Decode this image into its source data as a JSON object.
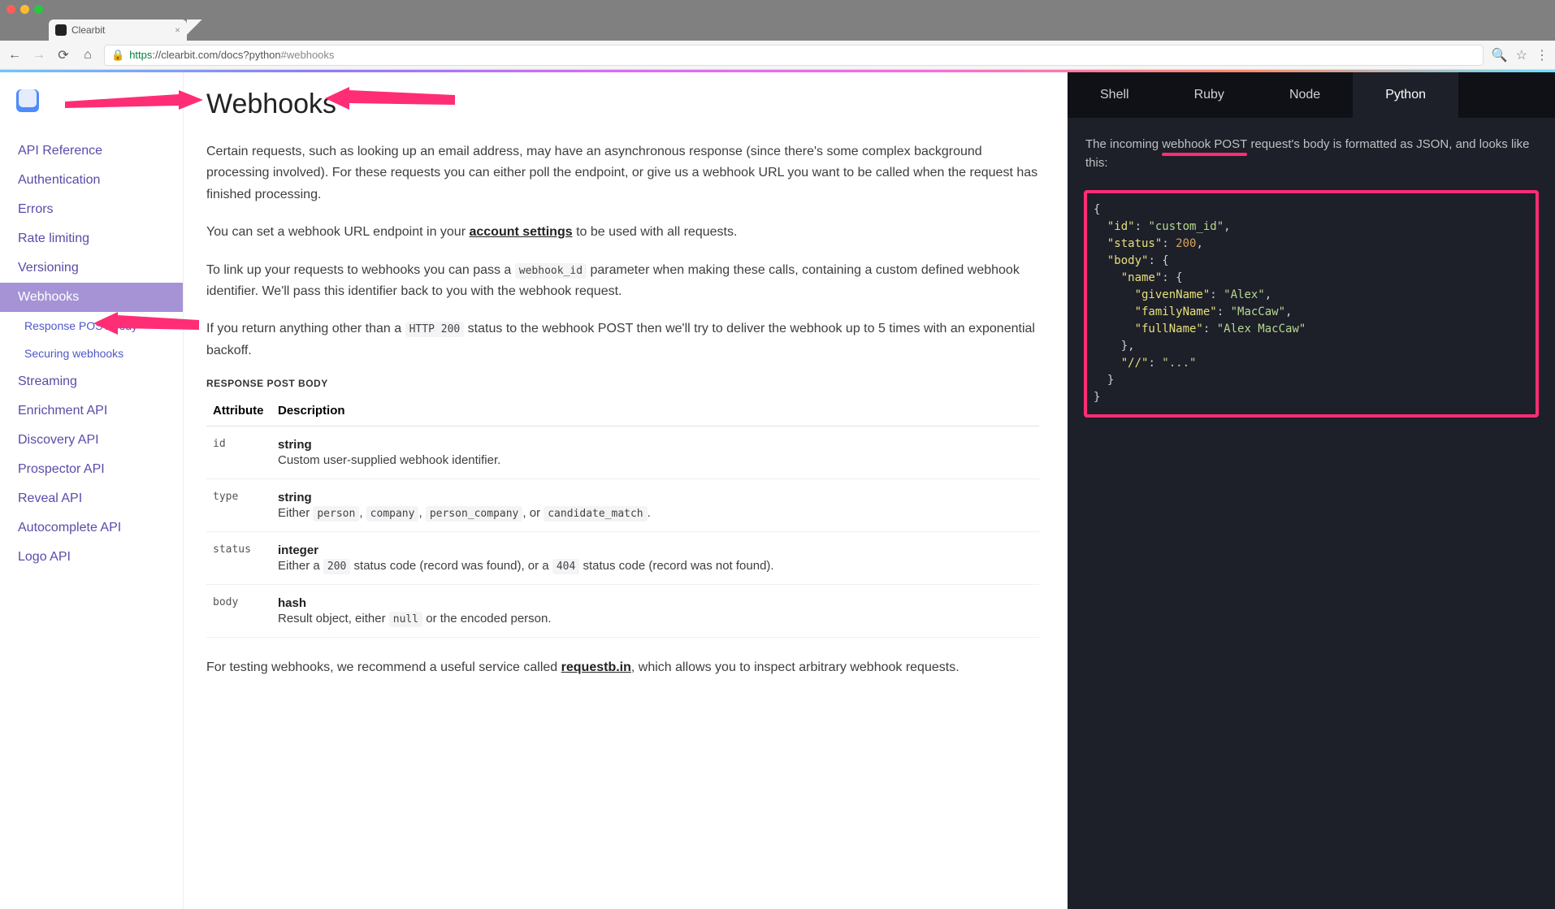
{
  "window": {
    "tab_title": "Clearbit",
    "url_scheme": "https",
    "url_host": "://clearbit.com",
    "url_path": "/docs?python",
    "url_fragment": "#webhooks"
  },
  "sidebar": {
    "items": [
      {
        "label": "API Reference"
      },
      {
        "label": "Authentication"
      },
      {
        "label": "Errors"
      },
      {
        "label": "Rate limiting"
      },
      {
        "label": "Versioning"
      },
      {
        "label": "Webhooks",
        "active": true,
        "subs": [
          "Response POST body",
          "Securing webhooks"
        ]
      },
      {
        "label": "Streaming"
      },
      {
        "label": "Enrichment API"
      },
      {
        "label": "Discovery API"
      },
      {
        "label": "Prospector API"
      },
      {
        "label": "Reveal API"
      },
      {
        "label": "Autocomplete API"
      },
      {
        "label": "Logo API"
      }
    ]
  },
  "content": {
    "h1": "Webhooks",
    "p1": "Certain requests, such as looking up an email address, may have an asynchronous response (since there's some complex background processing involved). For these requests you can either poll the endpoint, or give us a webhook URL you want to be called when the request has finished processing.",
    "p2a": "You can set a webhook URL endpoint in your ",
    "p2_link": "account settings",
    "p2b": " to be used with all requests.",
    "p3a": "To link up your requests to webhooks you can pass a ",
    "p3_code": "webhook_id",
    "p3b": " parameter when making these calls, containing a custom defined webhook identifier. We'll pass this identifier back to you with the webhook request.",
    "p4a": "If you return anything other than a ",
    "p4_code": "HTTP 200",
    "p4b": " status to the webhook POST then we'll try to deliver the webhook up to 5 times with an exponential backoff.",
    "section_sub": "RESPONSE POST BODY",
    "table": {
      "head_attr": "Attribute",
      "head_desc": "Description",
      "rows": [
        {
          "attr": "id",
          "type": "string",
          "desc": "Custom user-supplied webhook identifier."
        },
        {
          "attr": "type",
          "type": "string",
          "desc_pre": "Either ",
          "codes": [
            "person",
            "company",
            "person_company",
            "candidate_match"
          ],
          "desc_join": ", ",
          "desc_join_last": ", or ",
          "desc_post": "."
        },
        {
          "attr": "status",
          "type": "integer",
          "desc_pre": "Either a ",
          "code1": "200",
          "mid": " status code (record was found), or a ",
          "code2": "404",
          "desc_post": " status code (record was not found)."
        },
        {
          "attr": "body",
          "type": "hash",
          "desc_pre": "Result object, either ",
          "code1": "null",
          "desc_post": " or the encoded person."
        }
      ]
    },
    "p5a": "For testing webhooks, we recommend a useful service called ",
    "p5_link": "requestb.in",
    "p5b": ", which allows you to inspect arbitrary webhook requests."
  },
  "codepane": {
    "tabs": [
      "Shell",
      "Ruby",
      "Node",
      "Python"
    ],
    "active_tab": "Python",
    "desc_pre": "The incoming ",
    "desc_hl1": "webhook POST",
    "desc_mid": " request's body is formatted as JSON, and ",
    "desc_hl2": "looks like this:",
    "json": {
      "id": "custom_id",
      "status": 200,
      "body": {
        "name": {
          "givenName": "Alex",
          "familyName": "MacCaw",
          "fullName": "Alex MacCaw"
        }
      }
    }
  }
}
